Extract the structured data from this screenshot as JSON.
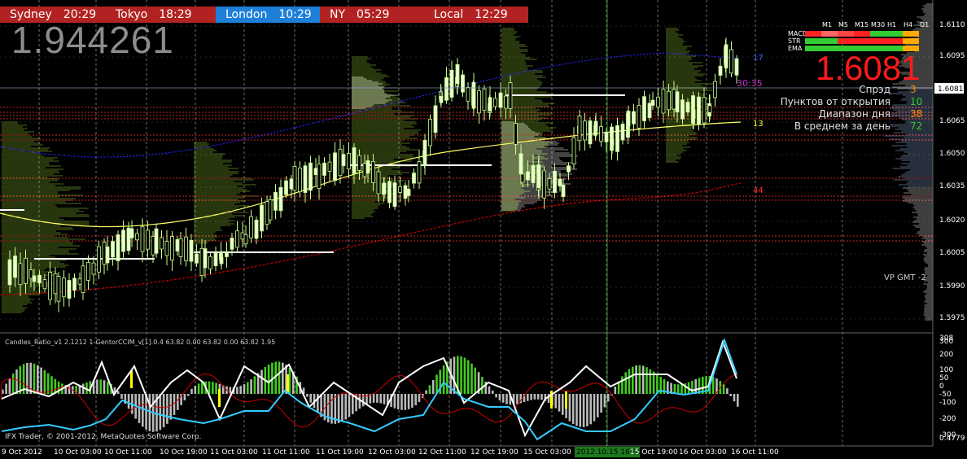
{
  "sessions": [
    {
      "name": "Sydney",
      "time": "20:29",
      "bg": "#b22222"
    },
    {
      "name": "Tokyo",
      "time": "18:29",
      "bg": "#b22222"
    },
    {
      "name": "London",
      "time": "10:29",
      "bg": "#1e7fd8"
    },
    {
      "name": "NY",
      "time": "05:29",
      "bg": "#b22222"
    },
    {
      "name": "Local",
      "time": "12:29",
      "bg": "#b22222"
    }
  ],
  "big_price": "1.944261",
  "bid_price": "1.6081",
  "current_price_label": "1.6081",
  "timer": "30:35",
  "level_17": "17",
  "level_13": "13",
  "level_44": "44",
  "info_panel": [
    {
      "label": "Спрэд",
      "value": "3",
      "color": "#ff8c00"
    },
    {
      "label": "Пунктов от открытия",
      "value": "10",
      "color": "#32cd32"
    },
    {
      "label": "Диапазон дня",
      "value": "38",
      "color": "#ff8c00"
    },
    {
      "label": "В среднем за день",
      "value": "72",
      "color": "#32cd32"
    }
  ],
  "tf_panel": {
    "headers": [
      "M1",
      "M5",
      "M15",
      "M30",
      "H1",
      "H4",
      "D1"
    ],
    "rows": [
      "MACD",
      "STR",
      "EMA"
    ]
  },
  "vp_label": "VP GMT -2",
  "indicator_label": "Candles_Ratio_v1 2.1212  1-GentorCCIM_v[1].0.4 63.82 0.00 63.82 0.00 63.82 1.95",
  "copyright": "IFX Trader, © 2001-2012, MetaQuotes Software Corp.",
  "price_axis": [
    "1.6110",
    "1.6095",
    "1.6081",
    "1.6065",
    "1.6050",
    "1.6035",
    "1.6020",
    "1.6005",
    "1.5990",
    "1.5975"
  ],
  "indicator_axis": [
    "308",
    "300",
    "200",
    "100",
    "50",
    "0",
    "-50",
    "-100",
    "-200",
    "-300",
    "0.4779"
  ],
  "time_axis": [
    "9 Oct 2012",
    "10 Oct 03:00",
    "10 Oct 11:00",
    "10 Oct 19:00",
    "11 Oct 03:00",
    "11 Oct 11:00",
    "11 Oct 19:00",
    "12 Oct 03:00",
    "12 Oct 11:00",
    "12 Oct 19:00",
    "15 Oct 03:00",
    "2012.10.15 16:00",
    "15 Oct 19:00",
    "16 Oct 03:00",
    "16 Oct 11:00"
  ],
  "colors": {
    "bull": "#c8ff8c",
    "ma_blue": "#1a1aff",
    "ma_yellow": "#ffff66",
    "ma_red": "#cc0000",
    "cyan": "#33ccff",
    "grid": "#ffffff"
  }
}
